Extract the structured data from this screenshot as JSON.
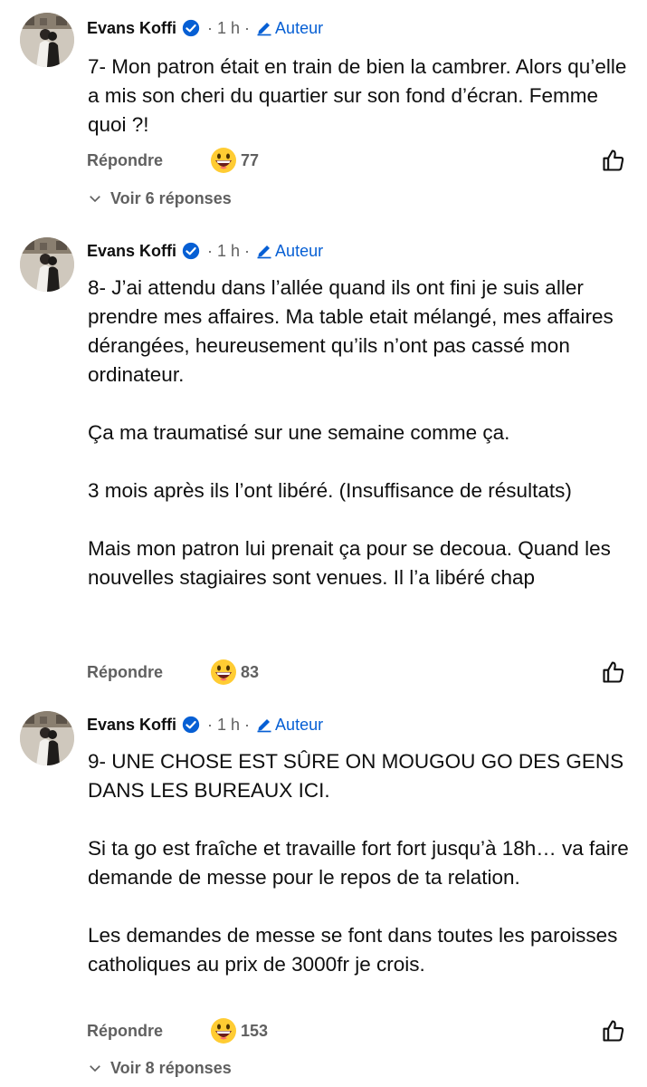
{
  "comments": [
    {
      "author": "Evans Koffi",
      "time": "· 1 h ·",
      "badge": "Auteur",
      "text": "7- Mon patron était en train de bien la cambrer. Alors qu’elle a mis son cheri du quartier sur son fond d’écran. Femme quoi ?!",
      "reply_label": "Répondre",
      "reaction_icon": "grinning-face-emoji",
      "reaction_count": "77",
      "view_replies": "Voir 6 réponses"
    },
    {
      "author": "Evans Koffi",
      "time": "· 1 h ·",
      "badge": "Auteur",
      "text": "8- J’ai attendu dans l’allée quand ils ont fini je suis aller prendre mes affaires. Ma table etait mélangé, mes affaires dérangées, heureusement qu’ils n’ont pas cassé mon ordinateur.\n\nÇa ma traumatisé sur une semaine comme ça.\n\n3 mois après ils l’ont libéré. (Insuffisance de résultats)\n\nMais mon patron lui prenait ça pour se decoua. Quand les nouvelles stagiaires sont venues. Il l’a libéré chap",
      "reply_label": "Répondre",
      "reaction_icon": "grinning-face-emoji",
      "reaction_count": "83"
    },
    {
      "author": "Evans Koffi",
      "time": "· 1 h ·",
      "badge": "Auteur",
      "text": "9- UNE CHOSE EST SÛRE ON MOUGOU GO DES GENS DANS LES BUREAUX ICI.\n\nSi ta go est fraîche et travaille fort fort jusqu’à 18h… va faire demande de messe pour le repos de ta relation.\n\nLes demandes de messe se font dans toutes les paroisses catholiques au prix de 3000fr je crois.",
      "reply_label": "Répondre",
      "reaction_icon": "grinning-face-emoji",
      "reaction_count": "153",
      "view_replies": "Voir 8 réponses"
    }
  ],
  "colors": {
    "accent_blue": "#065fd4",
    "secondary_text": "#606060",
    "primary_text": "#0f0f0f"
  }
}
